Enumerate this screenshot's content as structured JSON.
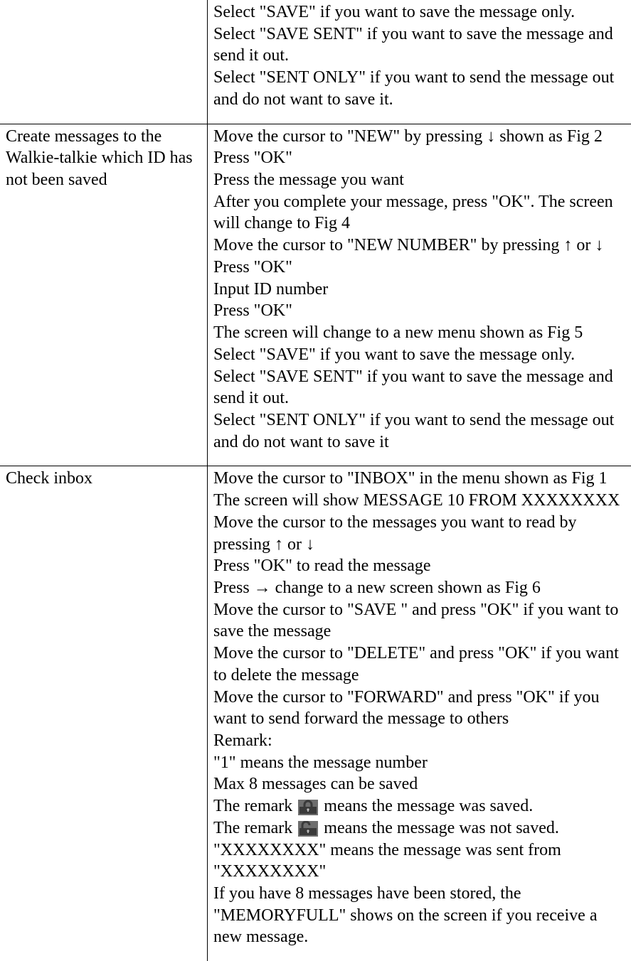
{
  "rows": [
    {
      "left": "",
      "right": [
        "Select \"SAVE\" if you want to save the message only.",
        "Select \"SAVE SENT\" if you want to save the message and send it out.",
        "Select \"SENT ONLY\" if you want to send the message out and do not want to save it."
      ]
    },
    {
      "left": "Create messages to the Walkie-talkie which ID has not been saved",
      "right": [
        "Move the cursor to \"NEW\" by pressing ↓ shown as Fig 2",
        "Press \"OK\"",
        "Press the message you want",
        "After you complete your message, press \"OK\".  The screen will change to Fig 4",
        "Move the cursor to \"NEW NUMBER\" by pressing ↑ or ↓",
        "Press \"OK\"",
        "Input ID number",
        "Press \"OK\"",
        "The screen will change to a new menu shown as Fig 5",
        "Select \"SAVE\" if you want to save the message only.",
        "Select \"SAVE SENT\" if you want to save the message and send it out.",
        "Select \"SENT ONLY\" if you want to send the message out and do not want to save it"
      ]
    },
    {
      "left": "Check inbox",
      "right_special": {
        "lines_before": [
          "Move the cursor to \"INBOX\" in the menu shown as Fig 1",
          "The screen will show MESSAGE 10 FROM XXXXXXXX",
          "Move the cursor to the messages you want to read by pressing ↑ or ↓",
          "Press \"OK\" to read the message",
          "Press → change to a new screen shown as Fig 6",
          "Move the cursor to \"SAVE \" and press \"OK\" if you want to save the message",
          "Move the cursor to \"DELETE\" and press \"OK\" if you want to delete the message",
          "Move the cursor to \"FORWARD\" and press \"OK\" if you want to send forward the message to others",
          "Remark:",
          "\"1\" means the message number",
          "Max 8 messages can be saved"
        ],
        "saved_line_prefix": "The remark ",
        "saved_line_suffix": " means the message was saved.",
        "not_saved_line_prefix": "The remark ",
        "not_saved_line_suffix": " means the message was not saved.",
        "lines_after": [
          "\"XXXXXXXX\" means the message was sent from \"XXXXXXXX\"",
          "If you have 8 messages have been stored, the \"MEMORYFULL\" shows on the screen if you receive a new message."
        ]
      }
    }
  ]
}
